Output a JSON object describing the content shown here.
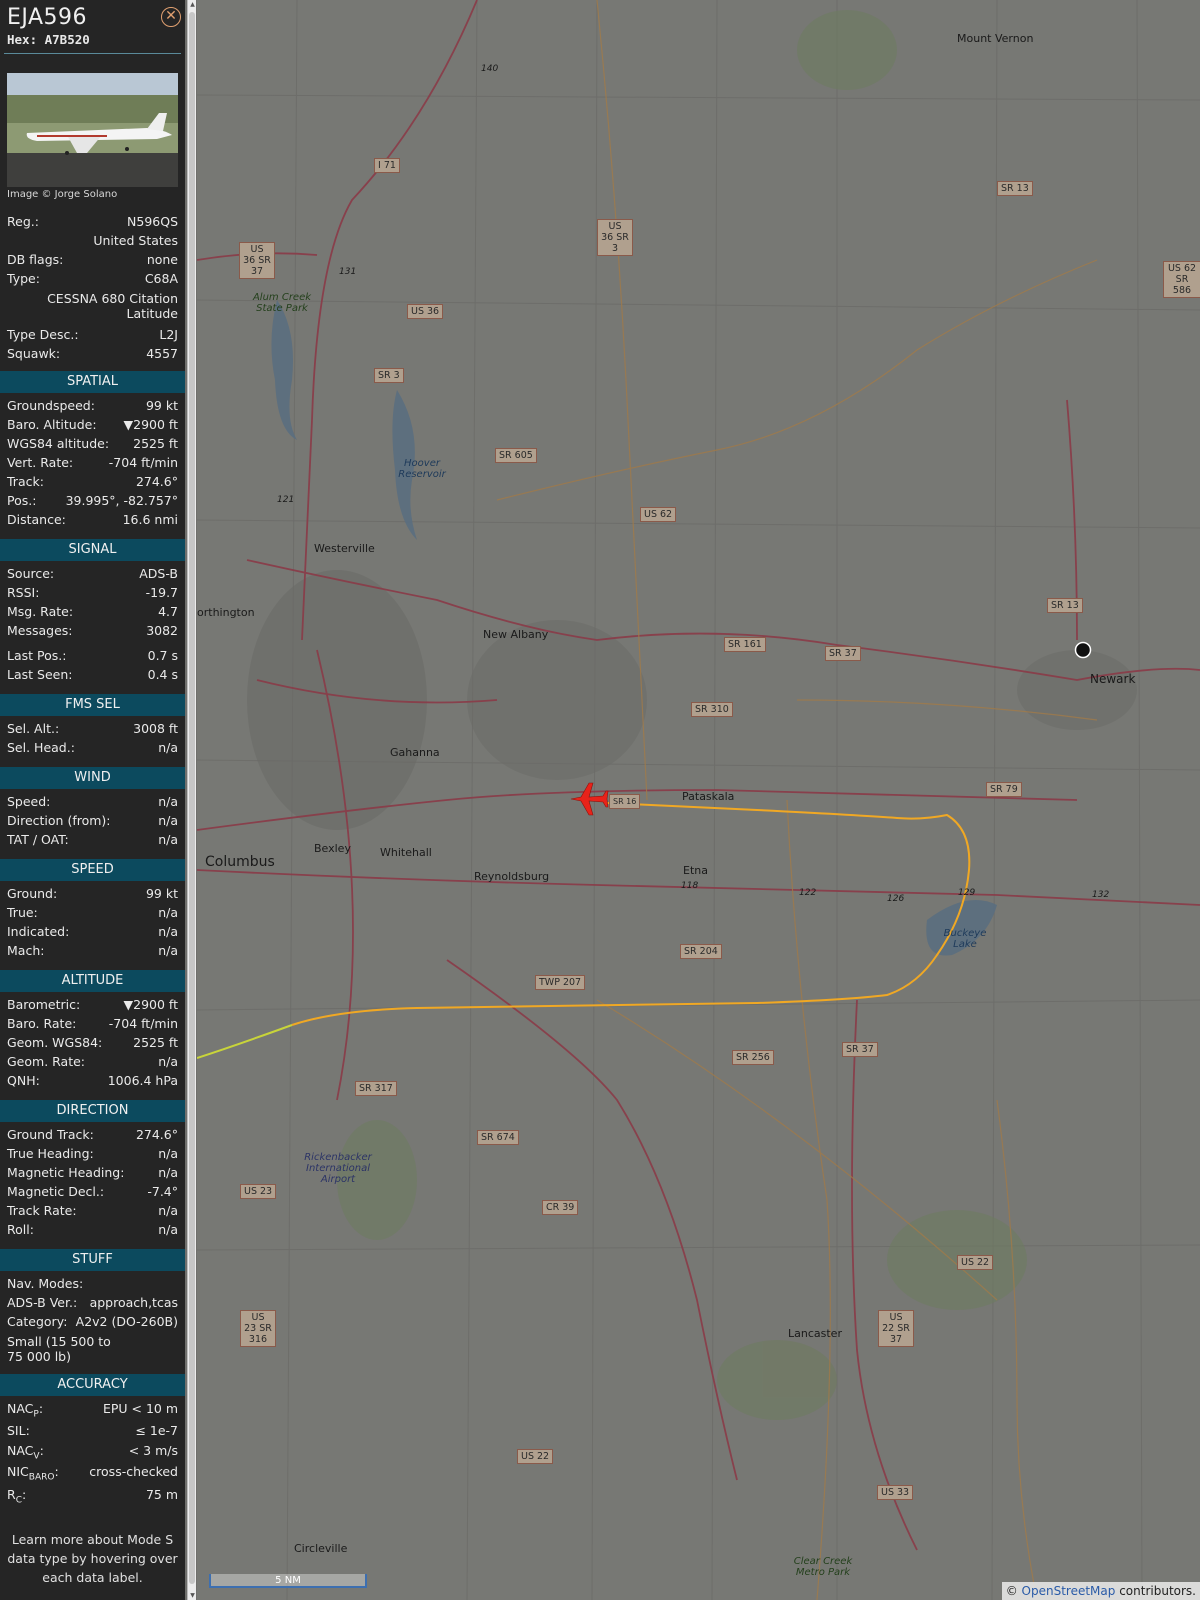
{
  "header": {
    "callsign": "EJA596",
    "hex": "Hex: A7B520",
    "close_icon": "close-circle-icon"
  },
  "photo": {
    "credit": "Image © Jorge Solano"
  },
  "identity": {
    "reg_label": "Reg.:",
    "reg": "N596QS",
    "country": "United States",
    "dbflags_label": "DB flags:",
    "dbflags": "none",
    "type_label": "Type:",
    "type": "C68A",
    "type_name_1": "CESSNA 680 Citation",
    "type_name_2": "Latitude",
    "typedesc_label": "Type Desc.:",
    "typedesc": "L2J",
    "squawk_label": "Squawk:",
    "squawk": "4557"
  },
  "spatial": {
    "title": "SPATIAL",
    "rows": [
      {
        "k": "Groundspeed:",
        "v": "99 kt"
      },
      {
        "k": "Baro. Altitude:",
        "v": "▼2900 ft"
      },
      {
        "k": "WGS84 altitude:",
        "v": "2525 ft"
      },
      {
        "k": "Vert. Rate:",
        "v": "-704 ft/min"
      },
      {
        "k": "Track:",
        "v": "274.6°"
      },
      {
        "k": "Pos.:",
        "v": "39.995°, -82.757°"
      },
      {
        "k": "Distance:",
        "v": "16.6 nmi"
      }
    ]
  },
  "signal": {
    "title": "SIGNAL",
    "rows": [
      {
        "k": "Source:",
        "v": "ADS-B"
      },
      {
        "k": "RSSI:",
        "v": "-19.7"
      },
      {
        "k": "Msg. Rate:",
        "v": "4.7"
      },
      {
        "k": "Messages:",
        "v": "3082"
      },
      {
        "k": "Last Pos.:",
        "v": "0.7 s"
      },
      {
        "k": "Last Seen:",
        "v": "0.4 s"
      }
    ]
  },
  "fms": {
    "title": "FMS SEL",
    "rows": [
      {
        "k": "Sel. Alt.:",
        "v": "3008 ft"
      },
      {
        "k": "Sel. Head.:",
        "v": "n/a"
      }
    ]
  },
  "wind": {
    "title": "WIND",
    "rows": [
      {
        "k": "Speed:",
        "v": "n/a"
      },
      {
        "k": "Direction (from):",
        "v": "n/a"
      },
      {
        "k": "TAT / OAT:",
        "v": "n/a"
      }
    ]
  },
  "speed": {
    "title": "SPEED",
    "rows": [
      {
        "k": "Ground:",
        "v": "99 kt"
      },
      {
        "k": "True:",
        "v": "n/a"
      },
      {
        "k": "Indicated:",
        "v": "n/a"
      },
      {
        "k": "Mach:",
        "v": "n/a"
      }
    ]
  },
  "altitude": {
    "title": "ALTITUDE",
    "rows": [
      {
        "k": "Barometric:",
        "v": "▼2900 ft"
      },
      {
        "k": "Baro. Rate:",
        "v": "-704 ft/min"
      },
      {
        "k": "Geom. WGS84:",
        "v": "2525 ft"
      },
      {
        "k": "Geom. Rate:",
        "v": "n/a"
      },
      {
        "k": "QNH:",
        "v": "1006.4 hPa"
      }
    ]
  },
  "direction": {
    "title": "DIRECTION",
    "rows": [
      {
        "k": "Ground Track:",
        "v": "274.6°"
      },
      {
        "k": "True Heading:",
        "v": "n/a"
      },
      {
        "k": "Magnetic Heading:",
        "v": "n/a"
      },
      {
        "k": "Magnetic Decl.:",
        "v": "-7.4°"
      },
      {
        "k": "Track Rate:",
        "v": "n/a"
      },
      {
        "k": "Roll:",
        "v": "n/a"
      }
    ]
  },
  "stuff": {
    "title": "STUFF",
    "navmodes_label": "Nav. Modes:",
    "navmodes": "",
    "adsb_label": "ADS-B Ver.:",
    "adsb": "approach,tcas",
    "category_label": "Category:",
    "category": "A2v2 (DO-260B)",
    "category_desc_1": "Small (15 500 to",
    "category_desc_2": "75 000 lb)"
  },
  "accuracy": {
    "title": "ACCURACY",
    "nacp_label": "NAC",
    "nacp_sub": "P",
    "nacp": "EPU < 10 m",
    "sil_label": "SIL:",
    "sil": "≤ 1e-7",
    "nacv_label": "NAC",
    "nacv_sub": "V",
    "nacv": "< 3 m/s",
    "nicbaro_label": "NIC",
    "nicbaro_sub": "BARO",
    "nicbaro": "cross-checked",
    "rc_label": "R",
    "rc_sub": "C",
    "rc": "75 m"
  },
  "learn": {
    "line1": "Learn more about Mode S",
    "line2": "data type by hovering over",
    "line3": "each data label."
  },
  "map": {
    "places": [
      "Mount Vernon",
      "Westerville",
      "New Albany",
      "Newark",
      "Gahanna",
      "Pataskala",
      "Bexley",
      "Whitehall",
      "Columbus",
      "Reynoldsburg",
      "Etna",
      "Lancaster",
      "Circleville",
      "Rickenbacker International Airport",
      "Alum Creek State Park",
      "Hoover Reservoir",
      "Buckeye Lake",
      "Clear Creek Metro Park",
      "orthington"
    ],
    "roads": [
      "I 71",
      "US 36 SR 3",
      "US 36 SR 37",
      "US 36",
      "SR 3",
      "SR 605",
      "US 62",
      "SR 13",
      "US 62 SR 586",
      "SR 161",
      "SR 37",
      "SR 310",
      "SR 79",
      "SR 16",
      "SR 204",
      "TWP 207",
      "SR 256",
      "SR 317",
      "SR 674",
      "CR 39",
      "US 23",
      "US 23 SR 316",
      "US 22",
      "US 22 SR 37",
      "US 33",
      "140",
      "131",
      "121",
      "118",
      "122",
      "126",
      "129",
      "132"
    ],
    "attribution_prefix": "©",
    "attribution_link": "OpenStreetMap",
    "attribution_suffix": "contributors.",
    "scale": "5 NM",
    "aircraft_color": "#e8231a",
    "track_color": "#f0a824",
    "track_old_color": "#c8d43a"
  }
}
